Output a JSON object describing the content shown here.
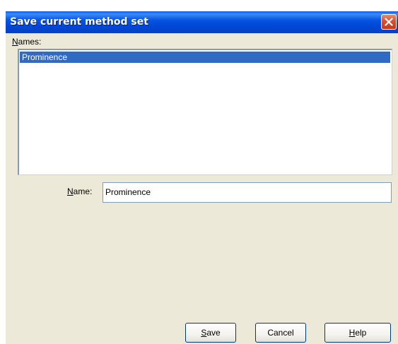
{
  "window": {
    "title": "Save current method set",
    "close_icon": "close-icon"
  },
  "names_label": {
    "accel": "N",
    "rest": "ames:"
  },
  "names_list": {
    "items": [
      {
        "label": "Prominence",
        "selected": true
      }
    ]
  },
  "name_label": {
    "accel": "N",
    "rest": "ame:"
  },
  "name_field": {
    "value": "Prominence"
  },
  "buttons": {
    "save": {
      "accel": "S",
      "rest": "ave"
    },
    "cancel": {
      "label": "Cancel"
    },
    "help": {
      "accel": "H",
      "rest": "elp"
    }
  },
  "colors": {
    "titlebar": "#0046d5",
    "selection": "#316ac5",
    "dialog_bg": "#ece9d8",
    "close_button": "#d8502f"
  }
}
